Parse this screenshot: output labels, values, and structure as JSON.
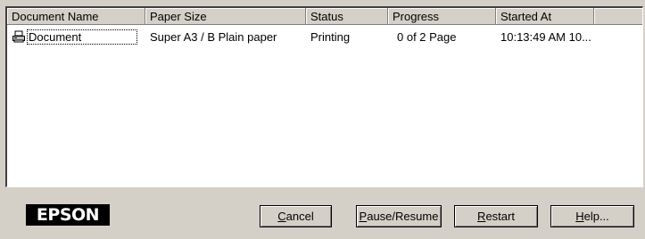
{
  "list": {
    "columns": [
      "Document Name",
      "Paper Size",
      "Status",
      "Progress",
      "Started At"
    ],
    "rows": [
      {
        "icon": "printer-icon",
        "document_name": "Document",
        "paper_size": "Super A3 / B Plain paper",
        "status": "Printing",
        "progress": "0 of 2  Page",
        "started_at": "10:13:49 AM 10..."
      }
    ]
  },
  "logo": {
    "text": "EPSON"
  },
  "buttons": {
    "cancel": {
      "mnemonic": "C",
      "rest": "ancel"
    },
    "pause_resume": {
      "mnemonic": "P",
      "rest": "ause/Resume"
    },
    "restart": {
      "mnemonic": "R",
      "rest": "estart"
    },
    "help": {
      "mnemonic": "H",
      "rest": "elp..."
    }
  },
  "colors": {
    "window_bg": "#d4d0c8",
    "list_bg": "#ffffff",
    "logo_bg": "#000000",
    "logo_fg": "#ffffff"
  }
}
